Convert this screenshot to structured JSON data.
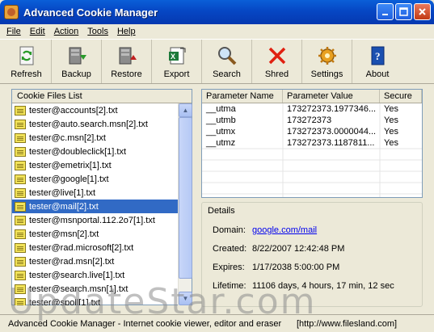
{
  "window": {
    "title": "Advanced Cookie Manager"
  },
  "menu": [
    "File",
    "Edit",
    "Action",
    "Tools",
    "Help"
  ],
  "toolbar": {
    "refresh": "Refresh",
    "backup": "Backup",
    "restore": "Restore",
    "export": "Export",
    "search": "Search",
    "shred": "Shred",
    "settings": "Settings",
    "about": "About"
  },
  "cookie_list": {
    "header": "Cookie Files List",
    "items": [
      "tester@accounts[2].txt",
      "tester@auto.search.msn[2].txt",
      "tester@c.msn[2].txt",
      "tester@doubleclick[1].txt",
      "tester@emetrix[1].txt",
      "tester@google[1].txt",
      "tester@live[1].txt",
      "tester@mail[2].txt",
      "tester@msnportal.112.2o7[1].txt",
      "tester@msn[2].txt",
      "tester@rad.microsoft[2].txt",
      "tester@rad.msn[2].txt",
      "tester@search.live[1].txt",
      "tester@search.msn[1].txt",
      "tester@spoll[1].txt"
    ],
    "selected_index": 7
  },
  "params": {
    "headers": [
      "Parameter Name",
      "Parameter Value",
      "Secure"
    ],
    "rows": [
      [
        "__utma",
        "173272373.1977346...",
        "Yes"
      ],
      [
        "__utmb",
        "173272373",
        "Yes"
      ],
      [
        "__utmx",
        "173272373.0000044...",
        "Yes"
      ],
      [
        "__utmz",
        "173272373.1187811...",
        "Yes"
      ]
    ]
  },
  "details": {
    "title": "Details",
    "domain_label": "Domain:",
    "domain_value": "google.com/mail",
    "created_label": "Created:",
    "created_value": "8/22/2007 12:42:48 PM",
    "expires_label": "Expires:",
    "expires_value": "1/17/2038 5:00:00 PM",
    "lifetime_label": "Lifetime:",
    "lifetime_value": "11106 days, 4 hours, 17 min, 12 sec"
  },
  "status": {
    "left": "Advanced Cookie Manager - Internet cookie viewer, editor and eraser",
    "right": "[http://www.filesland.com]"
  },
  "watermark": "UpdateStar.com"
}
